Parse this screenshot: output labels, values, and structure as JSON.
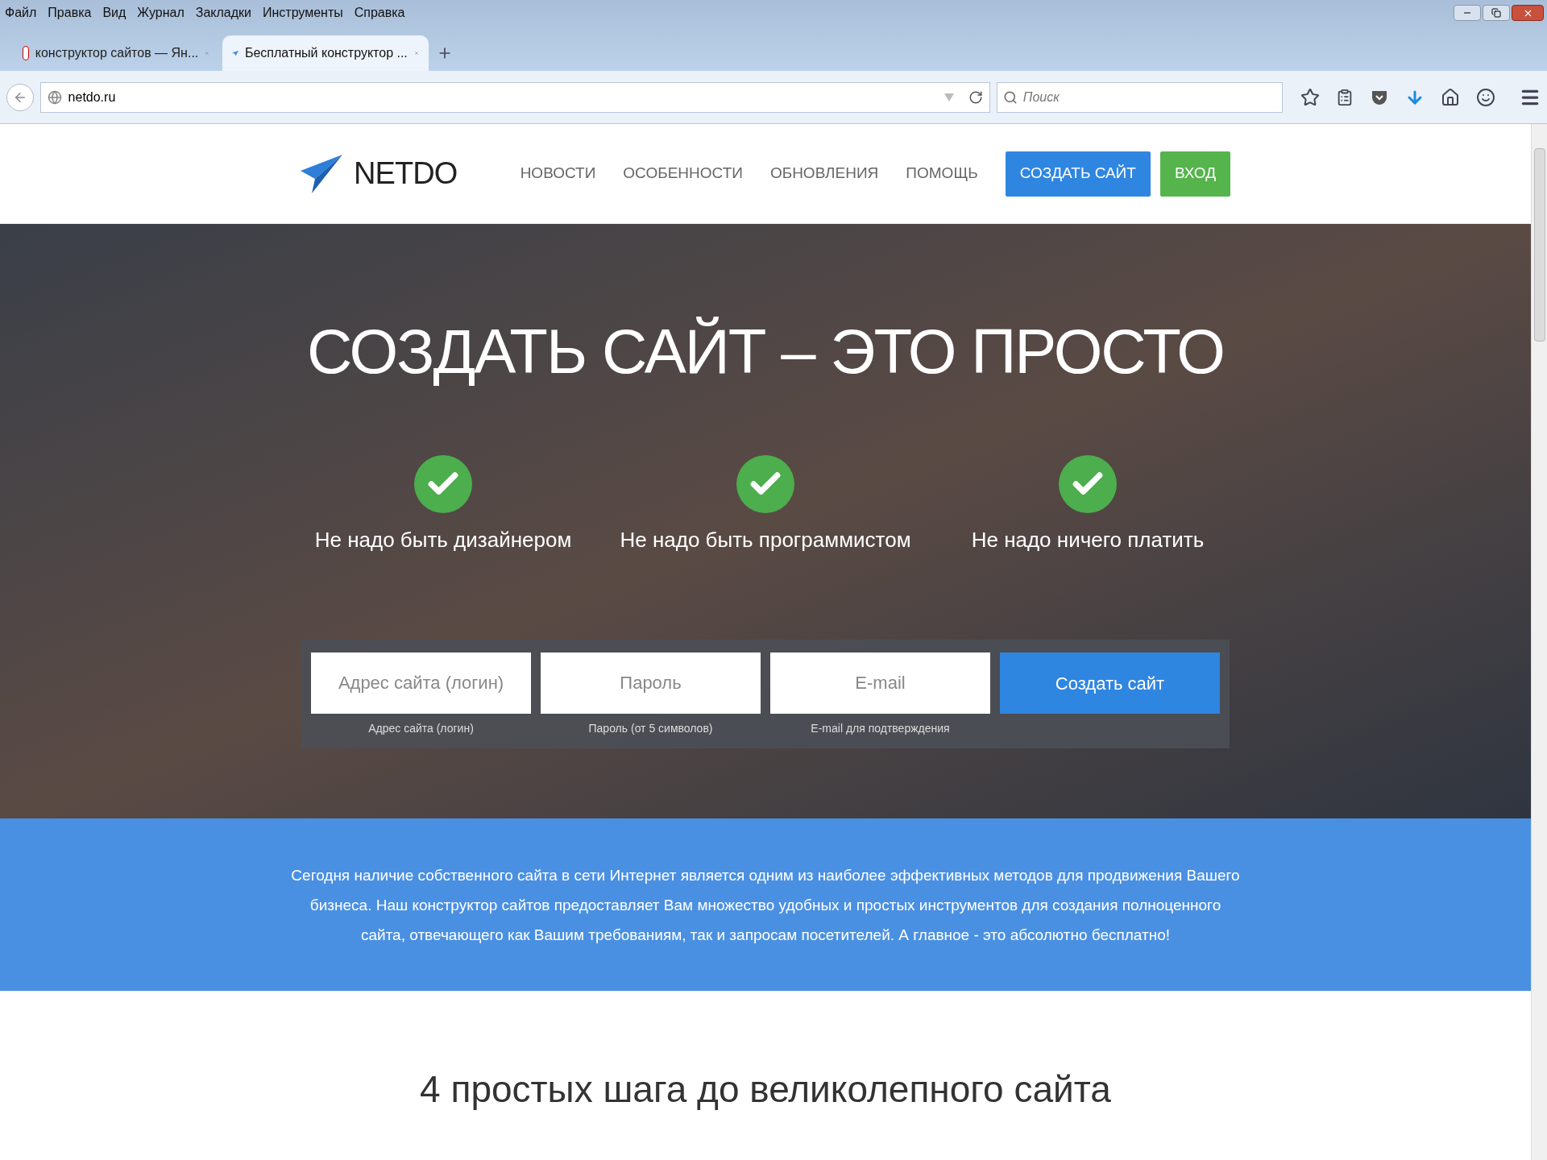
{
  "menu_bar": [
    "Файл",
    "Правка",
    "Вид",
    "Журнал",
    "Закладки",
    "Инструменты",
    "Справка"
  ],
  "tabs": [
    {
      "label": "конструктор сайтов — Ян...",
      "kind": "yandex",
      "selected": false
    },
    {
      "label": "Бесплатный конструктор ...",
      "kind": "plane",
      "selected": true
    }
  ],
  "address_bar": {
    "url": "netdo.ru"
  },
  "search": {
    "placeholder": "Поиск"
  },
  "site_header": {
    "logo": "NETDO",
    "nav": [
      "НОВОСТИ",
      "ОСОБЕННОСТИ",
      "ОБНОВЛЕНИЯ",
      "ПОМОЩЬ"
    ],
    "create_button": "СОЗДАТЬ САЙТ",
    "login_button": "ВХОД"
  },
  "hero": {
    "title": "СОЗДАТЬ САЙТ – ЭТО ПРОСТО",
    "features": [
      "Не надо быть дизайнером",
      "Не надо быть программистом",
      "Не надо ничего платить"
    ],
    "form": {
      "fields": [
        {
          "placeholder": "Адрес сайта (логин)",
          "hint": "Адрес сайта (логин)"
        },
        {
          "placeholder": "Пароль",
          "hint": "Пароль (от 5 символов)"
        },
        {
          "placeholder": "E-mail",
          "hint": "E-mail для подтверждения"
        }
      ],
      "submit": "Создать сайт"
    }
  },
  "intro": "Сегодня наличие собственного сайта в сети Интернет является одним из наиболее эффективных методов для продвижения Вашего бизнеса. Наш конструктор сайтов предоставляет Вам множество удобных и простых инструментов для создания полноценного сайта, отвечающего как Вашим требованиям, так и запросам посетителей. А главное - это абсолютно бесплатно!",
  "steps_heading": "4 простых шага до великолепного сайта"
}
